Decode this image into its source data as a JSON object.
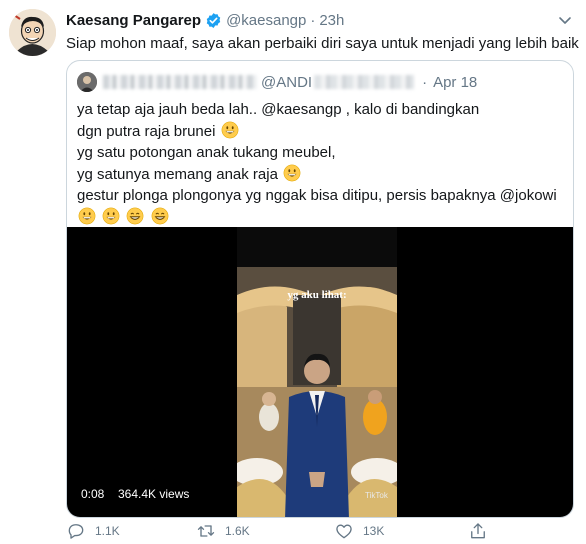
{
  "author": {
    "name": "Kaesang Pangarep",
    "handle": "@kaesangp",
    "separator": "·",
    "time": "23h",
    "verified_color": "#1da1f2"
  },
  "tweet_text": "Siap mohon maaf, saya akan perbaiki diri saya untuk menjadi yang lebih baik",
  "quote": {
    "handle_visible": "@ANDI",
    "separator": "·",
    "time": "Apr 18",
    "lines": [
      {
        "text": "ya tetap aja jauh beda lah.. @kaesangp , kalo di bandingkan",
        "emojis": []
      },
      {
        "text": "dgn  putra raja brunei ",
        "emojis": [
          "grinning-face"
        ]
      },
      {
        "text": "yg satu potongan anak tukang meubel,",
        "emojis": []
      },
      {
        "text": "yg satunya memang anak raja ",
        "emojis": [
          "grinning-face"
        ]
      },
      {
        "text": "gestur plonga plongonya yg nggak bisa ditipu,  persis bapaknya @jokowi",
        "emojis": []
      },
      {
        "text": "",
        "emojis": [
          "grinning-face",
          "grinning-face",
          "beaming-face",
          "beaming-face"
        ]
      }
    ],
    "video": {
      "overlay_text": "yg aku lihat:",
      "watermark": "TikTok",
      "duration": "0:08",
      "views": "364.4K views"
    }
  },
  "actions": {
    "reply_count": "1.1K",
    "retweet_count": "1.6K",
    "like_count": "13K"
  },
  "colors": {
    "text": "#14171a",
    "muted": "#657786",
    "border": "#ccd6dd",
    "accent": "#1da1f2"
  },
  "icons": [
    "verified-badge-icon",
    "chevron-down-icon",
    "reply-icon",
    "retweet-icon",
    "like-icon",
    "share-icon"
  ]
}
